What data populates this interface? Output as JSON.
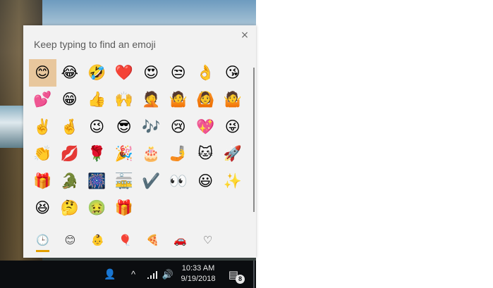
{
  "picker": {
    "search_placeholder": "Keep typing to find an emoji",
    "close_icon": "×",
    "emoji": [
      "😊",
      "😂",
      "🤣",
      "❤️",
      "😍",
      "😒",
      "👌",
      "😘",
      "💕",
      "😁",
      "👍",
      "🙌",
      "🤦",
      "🤷",
      "🙆",
      "🤷",
      "✌️",
      "🤞",
      "😉",
      "😎",
      "🎶",
      "😢",
      "💖",
      "😜",
      "👏",
      "💋",
      "🌹",
      "🎉",
      "🎂",
      "🤳",
      "🐱",
      "🚀",
      "🎁",
      "🐊",
      "🎆",
      "🚋",
      "✔️",
      "👀",
      "😃",
      "✨",
      "😆",
      "🤔",
      "🤢",
      "🎁"
    ],
    "selected_index": 0,
    "categories": [
      {
        "name": "recently-used",
        "glyph": "🕒",
        "active": true
      },
      {
        "name": "smileys-and-animals",
        "glyph": "😊",
        "active": false
      },
      {
        "name": "people",
        "glyph": "👶",
        "active": false
      },
      {
        "name": "celebrations-and-objects",
        "glyph": "🎈",
        "active": false
      },
      {
        "name": "food-and-plants",
        "glyph": "🍕",
        "active": false
      },
      {
        "name": "transportation-and-places",
        "glyph": "🚗",
        "active": false
      },
      {
        "name": "symbols",
        "glyph": "♡",
        "active": false
      }
    ],
    "accent_color": "#e4a000"
  },
  "taskbar": {
    "people_icon": "👤",
    "chevron_icon": "^",
    "network_icon": "wifi-icon",
    "volume_icon": "🔊",
    "time": "10:33 AM",
    "date": "9/19/2018",
    "notification_count": "8",
    "action_center_icon": "▤"
  }
}
